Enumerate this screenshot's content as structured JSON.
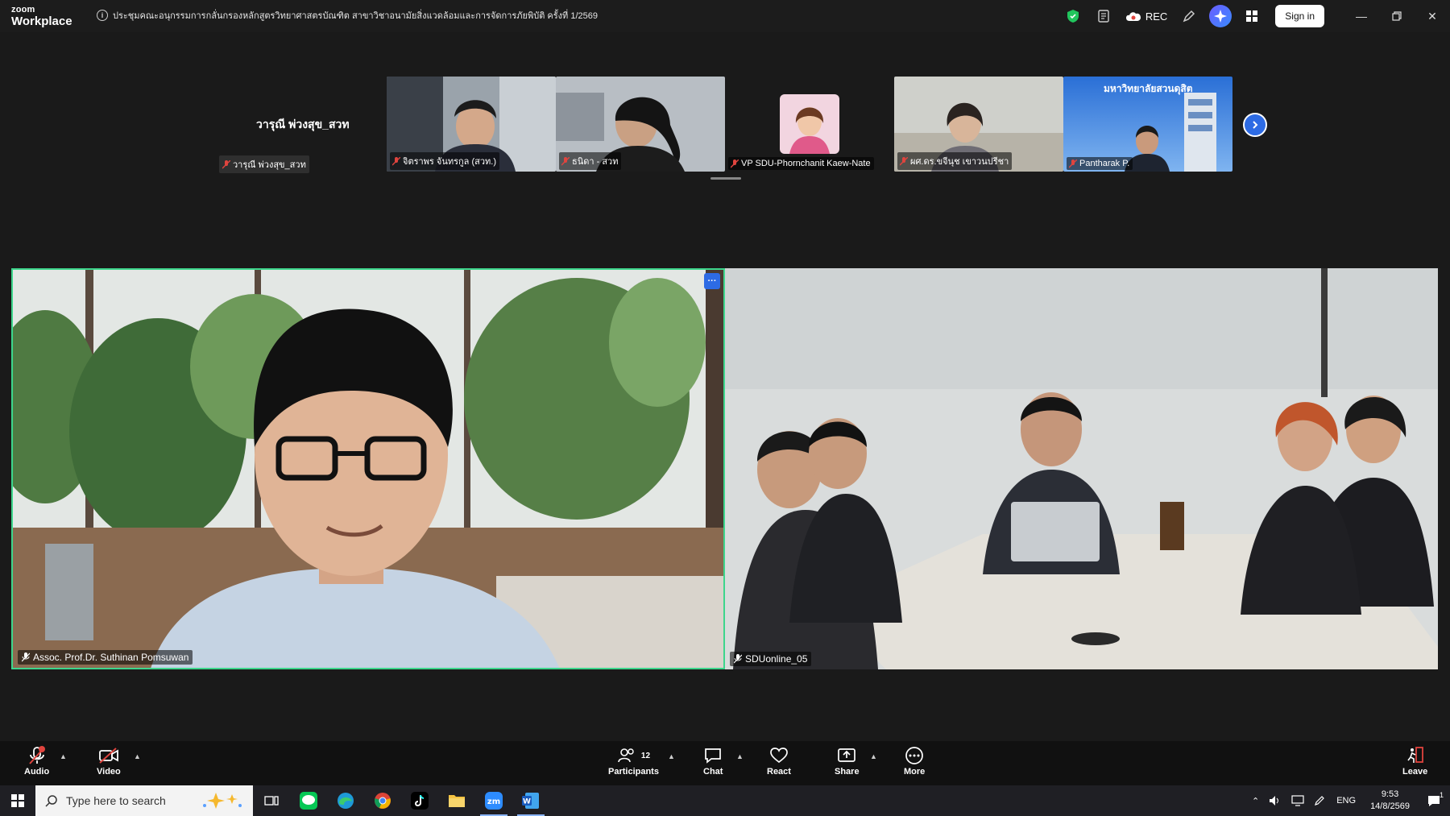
{
  "app": {
    "logo_top": "zoom",
    "logo_bottom": "Workplace",
    "meeting_title": "ประชุมคณะอนุกรรมการกลั่นกรองหลักสูตรวิทยาศาสตรบัณฑิต สาขาวิชาอนามัยสิ่งแวดล้อมและการจัดการภัยพิบัติ ครั้งที่ 1/2569",
    "rec_label": "REC",
    "signin_label": "Sign in"
  },
  "strip": {
    "active_speaker_name": "วารุณี พ่วงสุข_สวท",
    "active_speaker_label": "วารุณี พ่วงสุข_สวท",
    "thumbnails": [
      {
        "name": "จิตราพร จันทรกูล (สวท.)"
      },
      {
        "name": "ธนิดา - สวท"
      },
      {
        "name": "VP SDU-Phornchanit Kaew-Nate"
      },
      {
        "name": "ผศ.ดร.ขจีนุช เขาวนปรีชา"
      },
      {
        "name": "Pantharak P."
      }
    ],
    "banner_text": "มหาวิทยาลัยสวนดุสิต"
  },
  "tiles": {
    "left_name": "Assoc. Prof.Dr. Suthinan Pomsuwan",
    "right_name": "SDUonline_05",
    "more_label": "···"
  },
  "toolbar": {
    "audio": "Audio",
    "video": "Video",
    "participants": "Participants",
    "participants_count": "12",
    "chat": "Chat",
    "react": "React",
    "share": "Share",
    "more": "More",
    "leave": "Leave"
  },
  "taskbar": {
    "search_placeholder": "Type here to search",
    "lang": "ENG",
    "time": "9:53",
    "date": "14/8/2569",
    "notif_count": "1"
  },
  "colors": {
    "active_border": "#3dd68c",
    "accent_blue": "#2d6be4",
    "mic_red": "#e0443e"
  }
}
